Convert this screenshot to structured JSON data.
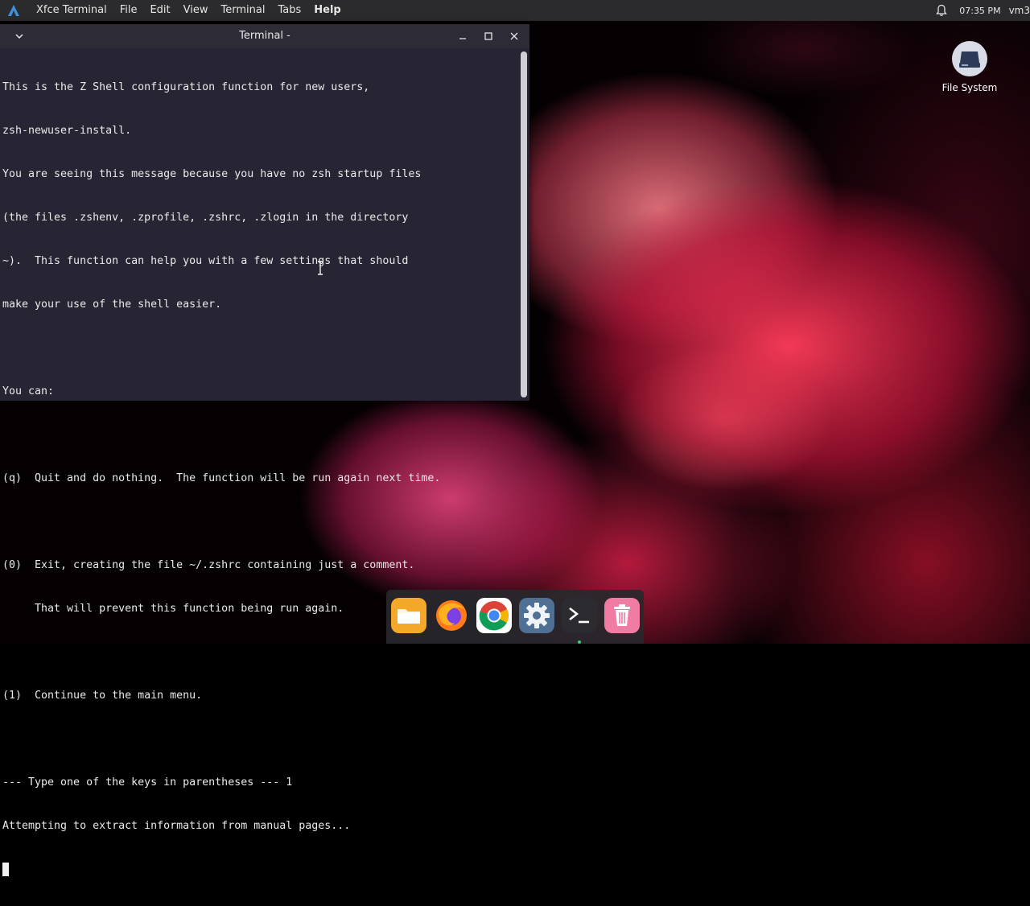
{
  "top_panel": {
    "app_name": "Xfce Terminal",
    "menus": [
      "File",
      "Edit",
      "View",
      "Terminal",
      "Tabs",
      "Help"
    ],
    "clock": "07:35 PM",
    "user": "vm3"
  },
  "terminal": {
    "title": "Terminal -",
    "lines": [
      "This is the Z Shell configuration function for new users,",
      "zsh-newuser-install.",
      "You are seeing this message because you have no zsh startup files",
      "(the files .zshenv, .zprofile, .zshrc, .zlogin in the directory",
      "~).  This function can help you with a few settings that should",
      "make your use of the shell easier.",
      "",
      "You can:",
      "",
      "(q)  Quit and do nothing.  The function will be run again next time.",
      "",
      "(0)  Exit, creating the file ~/.zshrc containing just a comment.",
      "     That will prevent this function being run again.",
      "",
      "(1)  Continue to the main menu.",
      "",
      "--- Type one of the keys in parentheses --- 1",
      "Attempting to extract information from manual pages..."
    ]
  },
  "desktop": {
    "icons": [
      {
        "label": "File System",
        "icon": "drive-icon"
      }
    ]
  },
  "dock": {
    "items": [
      {
        "name": "files",
        "icon": "folder-icon"
      },
      {
        "name": "firefox",
        "icon": "firefox-icon"
      },
      {
        "name": "chrome",
        "icon": "chrome-icon"
      },
      {
        "name": "settings",
        "icon": "gear-icon"
      },
      {
        "name": "terminal",
        "icon": "terminal-icon",
        "active": true
      },
      {
        "name": "trash",
        "icon": "trash-icon"
      }
    ]
  },
  "colors": {
    "panel_bg": "#2b2b2d",
    "terminal_bg": "#272533",
    "accent": "#3d8fe0"
  }
}
